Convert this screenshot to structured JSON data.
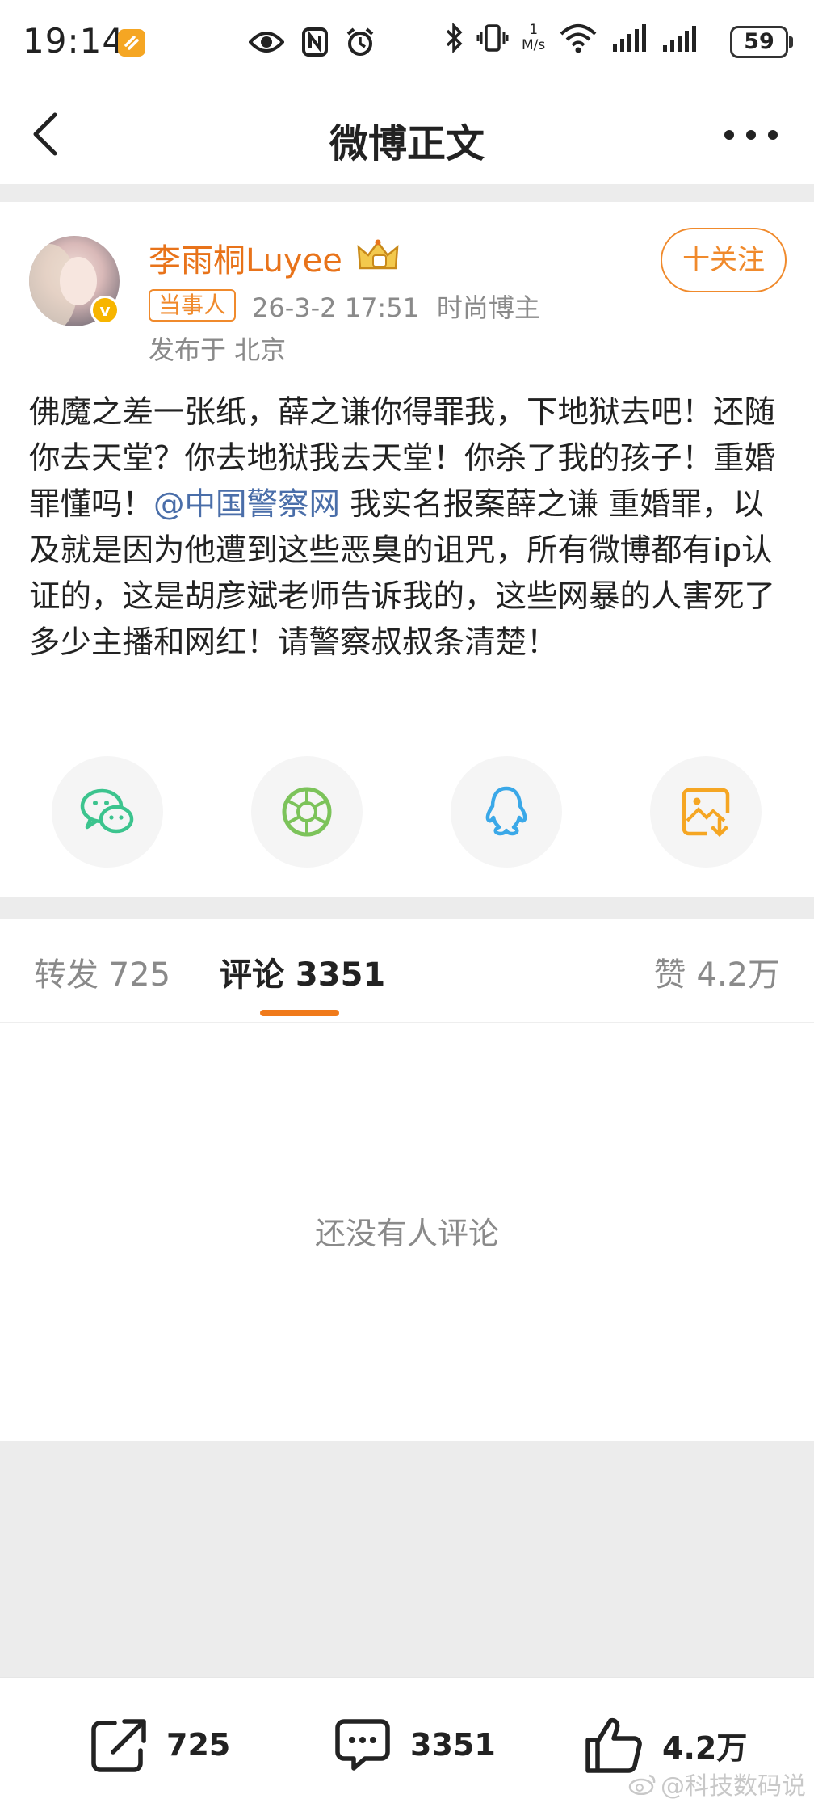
{
  "status_bar": {
    "time": "19:14",
    "net_speed_value": "1",
    "net_speed_unit": "M/s",
    "battery": "59",
    "wifi_label": "6"
  },
  "nav": {
    "title": "微博正文",
    "back_icon": "chevron-left-icon",
    "more_icon": "more-horizontal-icon"
  },
  "post": {
    "author": "李雨桐Luyee",
    "follow_label": "十关注",
    "tag": "当事人",
    "date": "26-3-2 17:51",
    "category": "时尚博主",
    "location": "发布于 北京",
    "body_before": "佛魔之差一张纸，薛之谦你得罪我，下地狱去吧！还随你去天堂？你去地狱我去天堂！你杀了我的孩子！重婚罪懂吗！",
    "mention": "@中国警察网",
    "body_after": " 我实名报案薛之谦 重婚罪，以及就是因为他遭到这些恶臭的诅咒，所有微博都有ip认证的，这是胡彦斌老师告诉我的，这些网暴的人害死了多少主播和网红！请警察叔叔条清楚！",
    "share_icons": [
      "wechat-icon",
      "moments-icon",
      "qq-icon",
      "save-image-icon"
    ]
  },
  "tabs": {
    "repost": "转发 725",
    "comment": "评论 3351",
    "like": "赞 4.2万"
  },
  "comments": {
    "empty": "还没有人评论"
  },
  "bottom_bar": {
    "repost_count": "725",
    "comment_count": "3351",
    "like_count": "4.2万"
  },
  "watermark": "@科技数码说",
  "colors": {
    "accent": "#f08a2c",
    "name": "#e8731a",
    "mention": "#4a6ea9",
    "wechat": "#3cc48e",
    "moments": "#7cc35a",
    "qq": "#3aa8e8",
    "save": "#f5a623"
  }
}
